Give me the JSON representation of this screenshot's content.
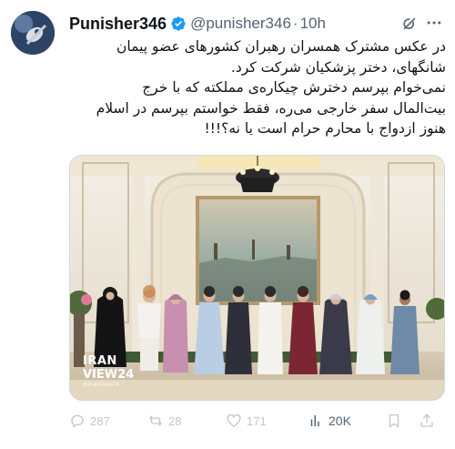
{
  "author": {
    "name": "Punisher346",
    "handle": "@punisher346",
    "separator": "·",
    "time": "10h"
  },
  "tweet": {
    "lines": [
      "در عکس مشترک همسران رهبران کشورهای عضو پیمان",
      "شانگهای، دختر پزشکیان شرکت کرد.",
      "نمی‌خوام بپرسم دخترش چیکاره‌ی مملکته که با خرج",
      "بیت‌المال سفر خارجی می‌ره، فقط خواستم بپرسم در اسلام",
      "هنوز ازدواج با محارم حرام است یا نه؟!!!"
    ]
  },
  "media": {
    "watermark_line1": "IRAN",
    "watermark_line2": "VIEW24",
    "watermark_line3": "@IranView24"
  },
  "actions": {
    "replies": "287",
    "reposts": "28",
    "likes": "171",
    "views": "20K"
  },
  "colors": {
    "verified": "#1d9bf0",
    "muted": "#536471",
    "text": "#0f1419"
  },
  "icons": [
    "grok-icon",
    "more-icon",
    "verified-badge-icon",
    "reply-icon",
    "repost-icon",
    "like-icon",
    "views-icon",
    "bookmark-icon",
    "share-icon"
  ]
}
